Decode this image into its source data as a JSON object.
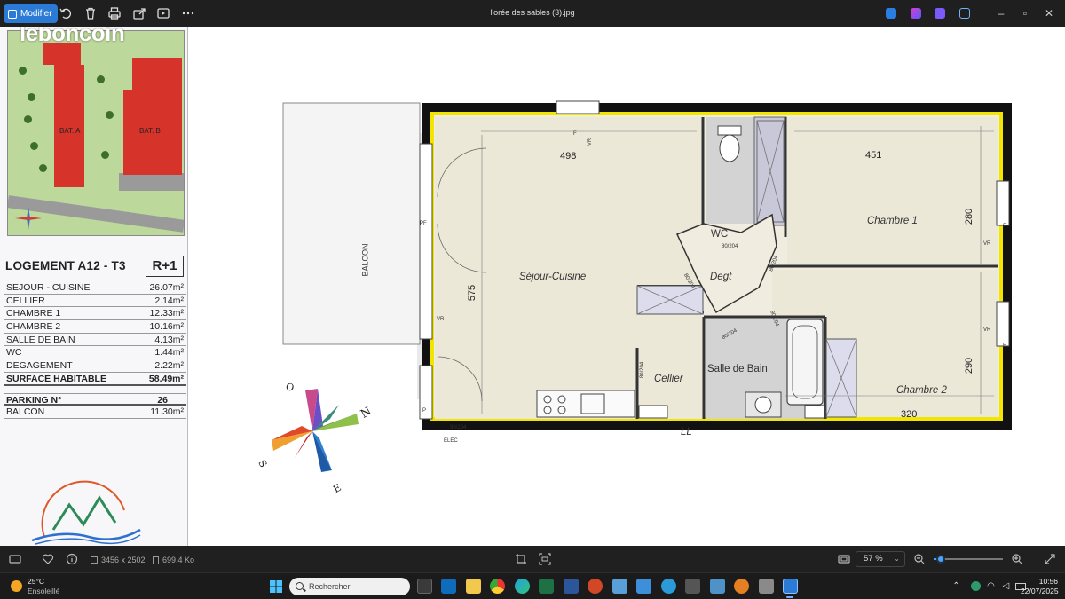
{
  "window": {
    "title": "l'orée des sables (3).jpg",
    "modify_label": "Modifier"
  },
  "toolbar": {
    "icons": [
      "rotate-icon",
      "delete-icon",
      "print-icon",
      "share-icon",
      "slideshow-icon",
      "more-icon"
    ]
  },
  "plan_sheet": {
    "brand": "leboncoin",
    "site_labels": [
      "BAT. A",
      "BAT. B"
    ],
    "logement_title": "LOGEMENT A12 - T3",
    "level": "R+1",
    "surfaces": [
      {
        "label": "SEJOUR - CUISINE",
        "value": "26.07m²"
      },
      {
        "label": "CELLIER",
        "value": "2.14m²"
      },
      {
        "label": "CHAMBRE 1",
        "value": "12.33m²"
      },
      {
        "label": "CHAMBRE 2",
        "value": "10.16m²"
      },
      {
        "label": "SALLE DE BAIN",
        "value": "4.13m²"
      },
      {
        "label": "WC",
        "value": "1.44m²"
      },
      {
        "label": "DEGAGEMENT",
        "value": "2.22m²"
      }
    ],
    "total": {
      "label": "SURFACE HABITABLE",
      "value": "58.49m²"
    },
    "parking": {
      "label": "PARKING N°",
      "value": "26"
    },
    "balcon": {
      "label": "BALCON",
      "value": "11.30m²"
    },
    "rooms": {
      "sejour": "Séjour-Cuisine",
      "wc": "WC",
      "degt": "Degt",
      "chambre1": "Chambre 1",
      "chambre2": "Chambre 2",
      "sdb": "Salle de Bain",
      "cellier": "Cellier",
      "ll": "LL",
      "balcon": "BALCON"
    },
    "dimensions": {
      "d498": "498",
      "d451": "451",
      "d575": "575",
      "d280": "280",
      "d290": "290",
      "d320": "320"
    },
    "marks": {
      "pf": "PF",
      "vr": "VR",
      "f": "F",
      "p": "P",
      "elec": "ELEC",
      "door_8020": "80/204",
      "door_9020": "90/204"
    },
    "compass": {
      "n": "N",
      "e": "E",
      "s": "S",
      "o": "O"
    }
  },
  "statusbar": {
    "dimensions": "3456 x 2502",
    "filesize": "699.4 Ko",
    "zoom": "57 %",
    "zoom_fraction": 0.1
  },
  "taskbar": {
    "temperature": "25°C",
    "weather": "Ensoleillé",
    "search_placeholder": "Rechercher",
    "time": "10:56",
    "date": "22/07/2025"
  }
}
